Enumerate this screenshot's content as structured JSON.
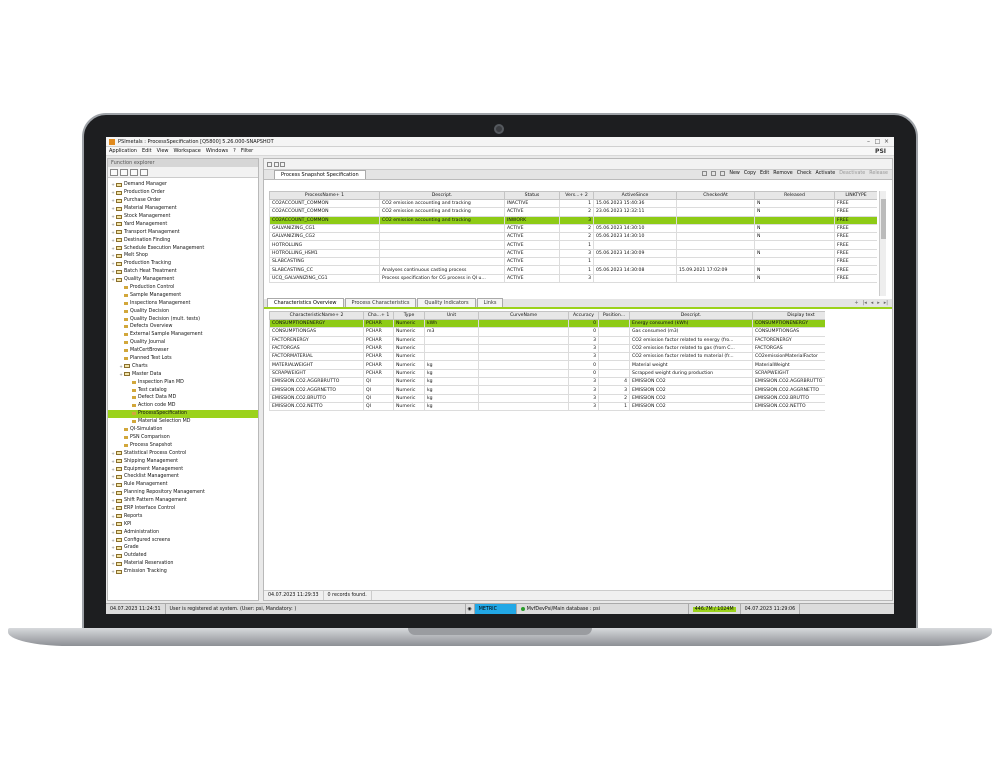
{
  "window": {
    "title": "PSImetals : ProcessSpecification [Q5800] 5.26.000-SNAPSHOT",
    "brand": "PSI"
  },
  "menu": [
    "Application",
    "Edit",
    "View",
    "Workspace",
    "Windows",
    "?",
    "Filter"
  ],
  "explorer": {
    "header": "Function explorer",
    "items": [
      {
        "label": "Demand Manager",
        "level": 0,
        "folder": true
      },
      {
        "label": "Production Order",
        "level": 0,
        "folder": true
      },
      {
        "label": "Purchase Order",
        "level": 0,
        "folder": true
      },
      {
        "label": "Material Management",
        "level": 0,
        "folder": true
      },
      {
        "label": "Stock Management",
        "level": 0,
        "folder": true
      },
      {
        "label": "Yard Management",
        "level": 0,
        "folder": true
      },
      {
        "label": "Transport Management",
        "level": 0,
        "folder": true
      },
      {
        "label": "Destination Finding",
        "level": 0,
        "folder": true
      },
      {
        "label": "Schedule Execution Management",
        "level": 0,
        "folder": true
      },
      {
        "label": "Melt Shop",
        "level": 0,
        "folder": true
      },
      {
        "label": "Production Tracking",
        "level": 0,
        "folder": true
      },
      {
        "label": "Batch Heat Treatment",
        "level": 0,
        "folder": true
      },
      {
        "label": "Quality Management",
        "level": 0,
        "folder": true
      },
      {
        "label": "Production Control",
        "level": 1,
        "folder": false
      },
      {
        "label": "Sample Management",
        "level": 1,
        "folder": false
      },
      {
        "label": "Inspections Management",
        "level": 1,
        "folder": false
      },
      {
        "label": "Quality Decision",
        "level": 1,
        "folder": false
      },
      {
        "label": "Quality Decision (mult. tests)",
        "level": 1,
        "folder": false
      },
      {
        "label": "Defects Overview",
        "level": 1,
        "folder": false
      },
      {
        "label": "External Sample Management",
        "level": 1,
        "folder": false
      },
      {
        "label": "Quality Journal",
        "level": 1,
        "folder": false
      },
      {
        "label": "MatCertBrowser",
        "level": 1,
        "folder": false
      },
      {
        "label": "Planned Test Lots",
        "level": 1,
        "folder": false
      },
      {
        "label": "Charts",
        "level": 1,
        "folder": true
      },
      {
        "label": "Master Data",
        "level": 1,
        "folder": true
      },
      {
        "label": "Inspection Plan MD",
        "level": 2,
        "folder": false
      },
      {
        "label": "Test catalog",
        "level": 2,
        "folder": false
      },
      {
        "label": "Defect Data MD",
        "level": 2,
        "folder": false
      },
      {
        "label": "Action code MD",
        "level": 2,
        "folder": false
      },
      {
        "label": "ProcessSpecification",
        "level": 2,
        "folder": false,
        "selected": true
      },
      {
        "label": "Material Selection MD",
        "level": 2,
        "folder": false
      },
      {
        "label": "QI-Simulation",
        "level": 1,
        "folder": false
      },
      {
        "label": "PSN Comparison",
        "level": 1,
        "folder": false
      },
      {
        "label": "Process Snapshot",
        "level": 1,
        "folder": false
      },
      {
        "label": "Statistical Process Control",
        "level": 0,
        "folder": true
      },
      {
        "label": "Shipping Management",
        "level": 0,
        "folder": true
      },
      {
        "label": "Equipment Management",
        "level": 0,
        "folder": true
      },
      {
        "label": "Checklist Management",
        "level": 0,
        "folder": true
      },
      {
        "label": "Rule Management",
        "level": 0,
        "folder": true
      },
      {
        "label": "Planning Repository Management",
        "level": 0,
        "folder": true
      },
      {
        "label": "Shift Pattern Management",
        "level": 0,
        "folder": true
      },
      {
        "label": "ERP Interface Control",
        "level": 0,
        "folder": true
      },
      {
        "label": "Reports",
        "level": 0,
        "folder": true
      },
      {
        "label": "KPI",
        "level": 0,
        "folder": true
      },
      {
        "label": "Administration",
        "level": 0,
        "folder": true
      },
      {
        "label": "Configured screens",
        "level": 0,
        "folder": true
      },
      {
        "label": "Grade",
        "level": 0,
        "folder": true
      },
      {
        "label": "Outdated",
        "level": 0,
        "folder": true
      },
      {
        "label": "Material Reservation",
        "level": 0,
        "folder": true
      },
      {
        "label": "Emission Tracking",
        "level": 0,
        "folder": true
      }
    ]
  },
  "main": {
    "tab": "Process Snapshot Specification",
    "actions": [
      "New",
      "Copy",
      "Edit",
      "Remove",
      "Check",
      "Activate"
    ],
    "disabled_actions": [
      "Deactivate",
      "Release"
    ],
    "spec_table": {
      "columns": [
        "ProcessName+ 1",
        "Descript.",
        "Status",
        "Vers...+ 2",
        "ActiveSince",
        "CheckedAt",
        "Released",
        "LINKTYPE"
      ],
      "rows": [
        [
          "CO2ACCOUNT_COMMON",
          "CO2 emission accounting and tracking",
          "INACTIVE",
          "1",
          "15.06.2023 15:40:36",
          "",
          "N",
          "FREE"
        ],
        [
          "CO2ACCOUNT_COMMON",
          "CO2 emission accounting and tracking",
          "ACTIVE",
          "2",
          "23.06.2023 12:32:11",
          "",
          "N",
          "FREE"
        ],
        [
          "CO2ACCOUNT_COMMON",
          "CO2 emission accounting and tracking",
          "INWORK",
          "3",
          "",
          "",
          "",
          "FREE"
        ],
        [
          "GALVANIZING_CG1",
          "",
          "ACTIVE",
          "2",
          "05.06.2023 14:30:10",
          "",
          "N",
          "FREE"
        ],
        [
          "GALVANIZING_CG2",
          "",
          "ACTIVE",
          "2",
          "05.06.2023 14:30:10",
          "",
          "N",
          "FREE"
        ],
        [
          "HOTROLLING",
          "",
          "ACTIVE",
          "1",
          "",
          "",
          "",
          "FREE"
        ],
        [
          "HOTROLLING_HSM1",
          "",
          "ACTIVE",
          "3",
          "05.06.2023 14:30:09",
          "",
          "N",
          "FREE"
        ],
        [
          "SLABCASTING",
          "",
          "ACTIVE",
          "1",
          "",
          "",
          "",
          "FREE"
        ],
        [
          "SLABCASTING_CC",
          "Analyses continuous casting process",
          "ACTIVE",
          "1",
          "05.06.2023 14:30:08",
          "15.09.2021 17:02:09",
          "N",
          "FREE"
        ],
        [
          "UCQ_GALVANIZING_CG1",
          "Process specification for CG process in QI u...",
          "ACTIVE",
          "3",
          "",
          "",
          "N",
          "FREE"
        ]
      ],
      "selected_row": 2
    },
    "sub_tabs": [
      "Characteristics Overview",
      "Process Characteristics",
      "Quality Indicators",
      "Links"
    ],
    "char_table": {
      "columns": [
        "CharacteristicName+ 2",
        "Cha...+ 1",
        "Type",
        "Unit",
        "CurveName",
        "Accuracy",
        "Position...",
        "Descript.",
        "Display text"
      ],
      "rows": [
        [
          "CONSUMPTIONENERGY",
          "PCHAR",
          "Numeric",
          "kWh",
          "",
          "0",
          "",
          "Energy consumed (kWh)",
          "CONSUMPTIONENERGY"
        ],
        [
          "CONSUMPTIONGAS",
          "PCHAR",
          "Numeric",
          "m3",
          "",
          "0",
          "",
          "Gas consumed (m3)",
          "CONSUMPTIONGAS"
        ],
        [
          "FACTORENERGY",
          "PCHAR",
          "Numeric",
          "",
          "",
          "3",
          "",
          "CO2 emission factor related to energy (fro...",
          "FACTORENERGY"
        ],
        [
          "FACTORGAS",
          "PCHAR",
          "Numeric",
          "",
          "",
          "3",
          "",
          "CO2 emission factor related to gas (from C...",
          "FACTORGAS"
        ],
        [
          "FACTORMATERIAL",
          "PCHAR",
          "Numeric",
          "",
          "",
          "3",
          "",
          "CO2 emission factor related to material (fr...",
          "CO2emissionMaterialFactor"
        ],
        [
          "MATERIALWEIGHT",
          "PCHAR",
          "Numeric",
          "kg",
          "",
          "0",
          "",
          "Material weight",
          "MaterialWeight"
        ],
        [
          "SCRAPWEIGHT",
          "PCHAR",
          "Numeric",
          "kg",
          "",
          "0",
          "",
          "Scrapped weight during production",
          "SCRAPWEIGHT"
        ],
        [
          "EMISSION.CO2.AGGRBRUTTO",
          "QI",
          "Numeric",
          "kg",
          "",
          "3",
          "4",
          "EMISSION CO2",
          "EMISSION.CO2.AGGRBRUTTO"
        ],
        [
          "EMISSION.CO2.AGGRNETTO",
          "QI",
          "Numeric",
          "kg",
          "",
          "3",
          "3",
          "EMISSION CO2",
          "EMISSION.CO2.AGGRNETTO"
        ],
        [
          "EMISSION.CO2.BRUTTO",
          "QI",
          "Numeric",
          "kg",
          "",
          "3",
          "2",
          "EMISSION CO2",
          "EMISSION.CO2.BRUTTO"
        ],
        [
          "EMISSION.CO2.NETTO",
          "QI",
          "Numeric",
          "kg",
          "",
          "3",
          "1",
          "EMISSION CO2",
          "EMISSION.CO2.NETTO"
        ]
      ],
      "selected_row": 0
    },
    "status": {
      "date": "04.07.2023 11:29:33",
      "records": "0 records found."
    }
  },
  "statusbar": {
    "date": "04.07.2023 11:24:31",
    "message": "User is registered at system. (User: psi, Mandatory: )",
    "units": "METRIC",
    "database": "MvfDevPsi/Main database : psi",
    "memory": "446.7M / 1024M",
    "time": "04.07.2023 11:29:06"
  },
  "colors": {
    "selection": "#9bd21b",
    "metric": "#22a8e6"
  }
}
